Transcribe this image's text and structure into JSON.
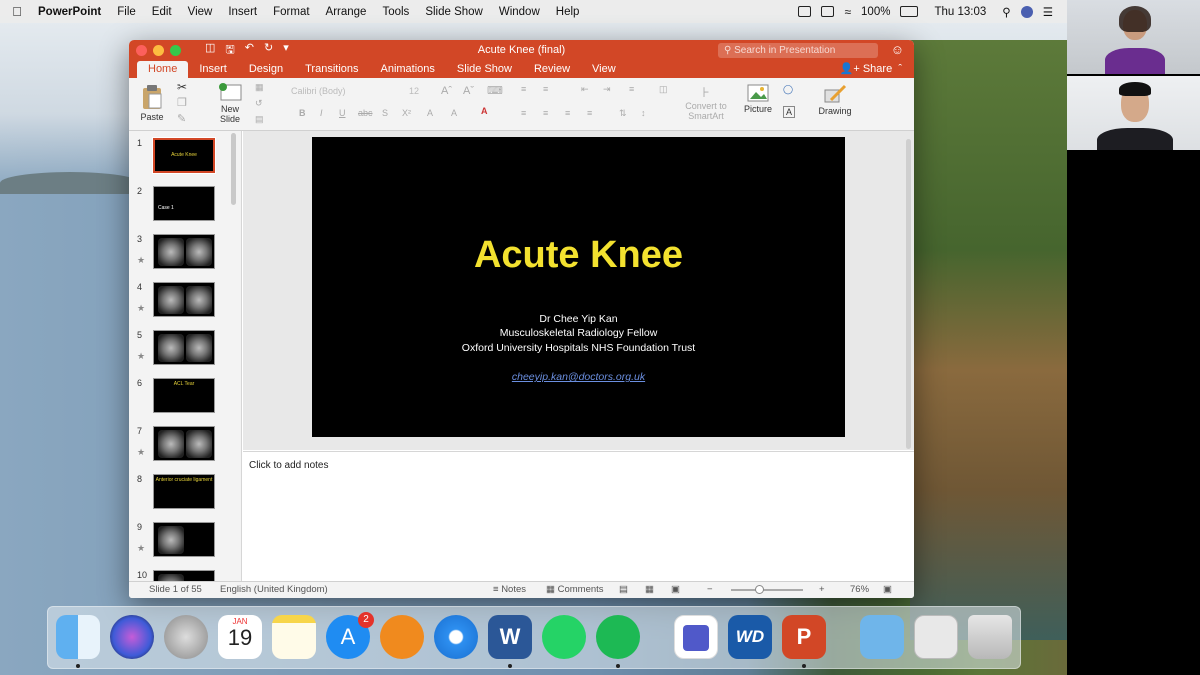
{
  "menubar": {
    "app": "PowerPoint",
    "items": [
      "File",
      "Edit",
      "View",
      "Insert",
      "Format",
      "Arrange",
      "Tools",
      "Slide Show",
      "Window",
      "Help"
    ],
    "battery": "100%",
    "clock": "Thu 13:03"
  },
  "window": {
    "title": "Acute Knee (final)",
    "search_placeholder": "Search in Presentation",
    "tabs": [
      "Home",
      "Insert",
      "Design",
      "Transitions",
      "Animations",
      "Slide Show",
      "Review",
      "View"
    ],
    "share": "Share"
  },
  "ribbon": {
    "paste": "Paste",
    "new_slide": [
      "New",
      "Slide"
    ],
    "font": "Calibri (Body)",
    "size": "12",
    "convert": [
      "Convert to",
      "SmartArt"
    ],
    "picture": "Picture",
    "drawing": "Drawing"
  },
  "thumbnails": [
    {
      "num": "1",
      "kind": "title",
      "text": "Acute Knee",
      "star": false
    },
    {
      "num": "2",
      "kind": "case",
      "text": "Case 1",
      "star": false
    },
    {
      "num": "3",
      "kind": "mri",
      "star": true
    },
    {
      "num": "4",
      "kind": "mri",
      "star": true
    },
    {
      "num": "5",
      "kind": "mri",
      "star": true
    },
    {
      "num": "6",
      "kind": "text",
      "text": "ACL Tear",
      "star": false
    },
    {
      "num": "7",
      "kind": "mri",
      "star": true
    },
    {
      "num": "8",
      "kind": "text",
      "text": "Anterior cruciate ligament",
      "star": false
    },
    {
      "num": "9",
      "kind": "mri",
      "star": true
    },
    {
      "num": "10",
      "kind": "mri",
      "star": false
    }
  ],
  "slide": {
    "title": "Acute Knee",
    "author": "Dr Chee Yip Kan",
    "role": "Musculoskeletal Radiology Fellow",
    "org": "Oxford University Hospitals NHS Foundation Trust",
    "email": "cheeyip.kan@doctors.org.uk"
  },
  "notes_placeholder": "Click to add notes",
  "status": {
    "slide_info": "Slide 1 of 55",
    "language": "English (United Kingdom)",
    "notes": "Notes",
    "comments": "Comments",
    "zoom": "76%",
    "zoom_level": 0.4
  },
  "dock": {
    "calendar_month": "JAN",
    "calendar_day": "19",
    "appstore_badge": "2",
    "word_letter": "W",
    "ppt_letter": "P",
    "wd": "WD"
  },
  "colors": {
    "accent": "#d24726",
    "slide_title": "#f3e12f"
  }
}
